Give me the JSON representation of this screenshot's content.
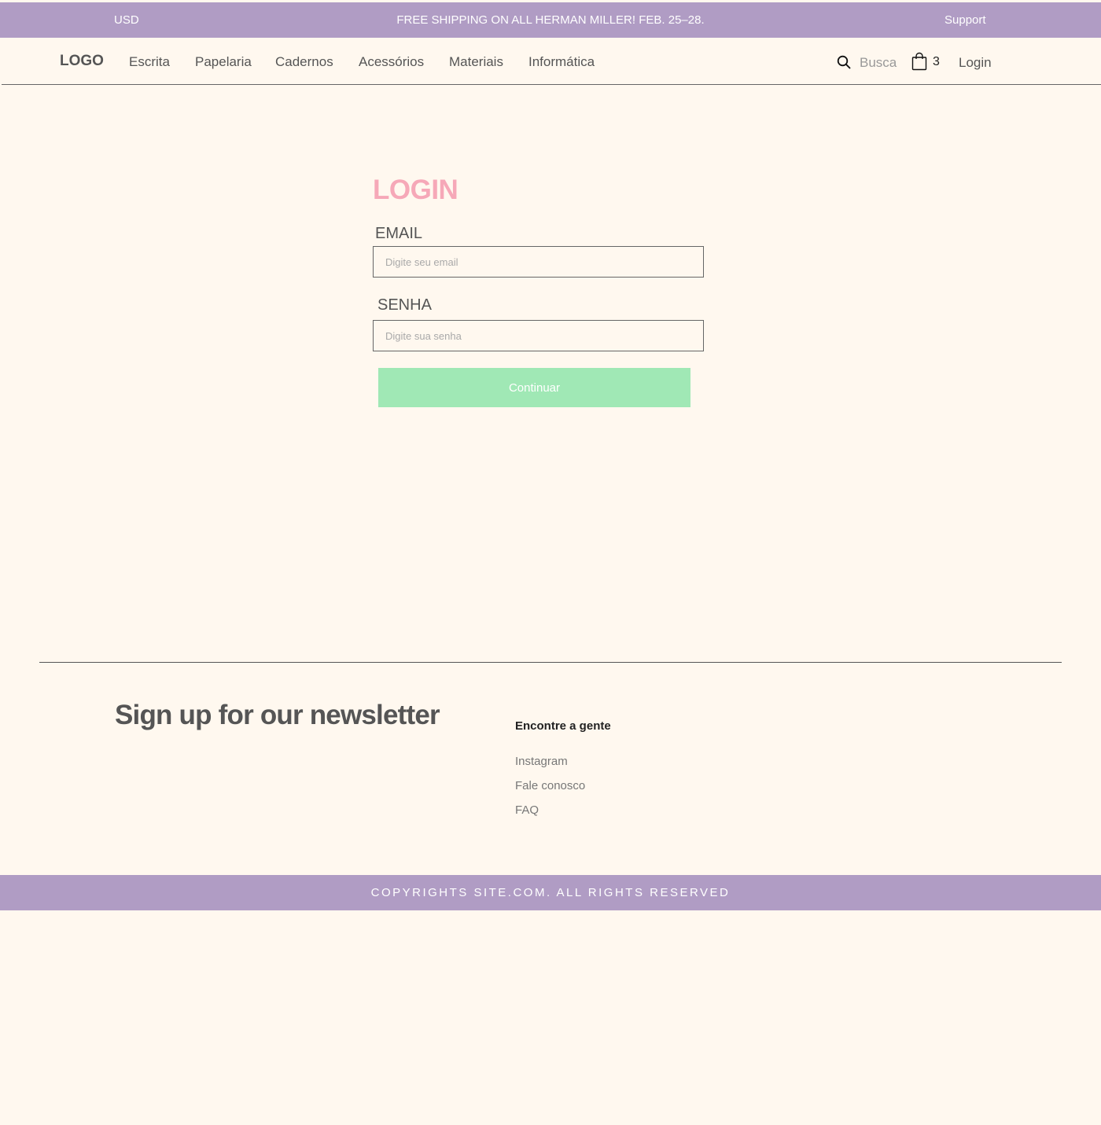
{
  "announcement": {
    "currency": "USD",
    "promo": "FREE SHIPPING ON ALL HERMAN MILLER! FEB. 25–28.",
    "support": "Support"
  },
  "header": {
    "logo": "LOGO",
    "nav": [
      "Escrita",
      "Papelaria",
      "Cadernos",
      "Acessórios",
      "Materiais",
      "Informática"
    ],
    "search_label": "Busca",
    "cart_count": "3",
    "login": "Login"
  },
  "login_form": {
    "title": "LOGIN",
    "email_label": "EMAIL",
    "email_placeholder": "Digite seu email",
    "email_value": "",
    "password_label": "SENHA",
    "password_placeholder": "Digite sua senha",
    "password_value": "",
    "submit_label": "Continuar"
  },
  "footer": {
    "newsletter_heading": "Sign up for our newsletter",
    "find_us_heading": "Encontre a gente",
    "links": [
      "Instagram",
      "Fale conosco",
      "FAQ"
    ],
    "copyright": "COPYRIGHTS SITE.COM. ALL RIGHTS RESERVED"
  },
  "colors": {
    "bar_purple": "#b09cc4",
    "page_bg": "#fff8ef",
    "login_title_pink": "#f6a8b8",
    "button_green": "#a0e8b5"
  },
  "icons": {
    "search": "search-icon",
    "cart": "shopping-bag-icon"
  }
}
